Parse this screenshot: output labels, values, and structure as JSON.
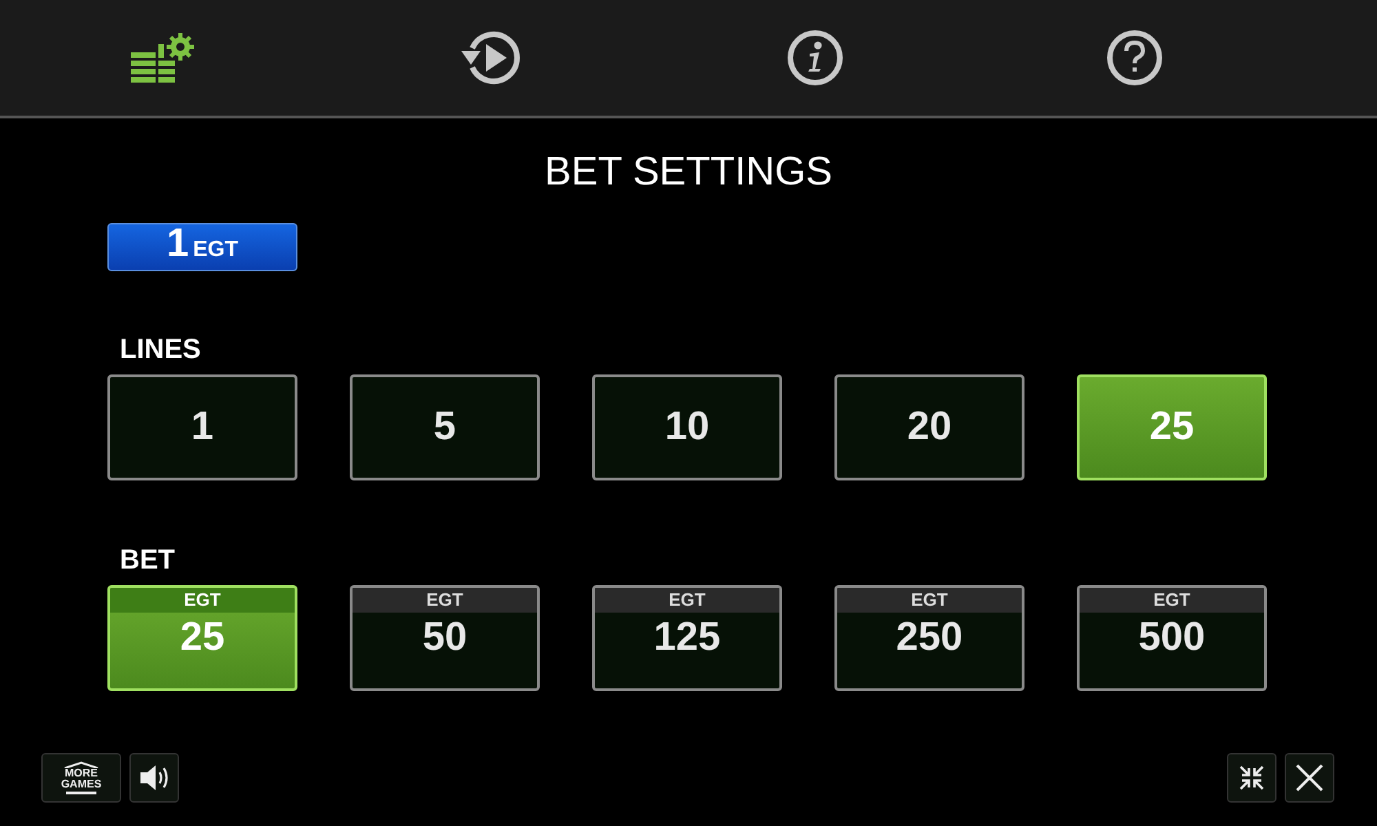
{
  "toolbar": [
    {
      "kind": "bet-settings",
      "selected": true
    },
    {
      "kind": "autoplay",
      "selected": false
    },
    {
      "kind": "info",
      "selected": false
    },
    {
      "kind": "help",
      "selected": false
    }
  ],
  "title": "BET SETTINGS",
  "denomination": {
    "value": "1",
    "unit": "EGT"
  },
  "lines": {
    "label": "LINES",
    "options": [
      {
        "value": "1",
        "selected": false
      },
      {
        "value": "5",
        "selected": false
      },
      {
        "value": "10",
        "selected": false
      },
      {
        "value": "20",
        "selected": false
      },
      {
        "value": "25",
        "selected": true
      }
    ]
  },
  "bet": {
    "label": "BET",
    "options": [
      {
        "currency": "EGT",
        "value": "25",
        "selected": true
      },
      {
        "currency": "EGT",
        "value": "50",
        "selected": false
      },
      {
        "currency": "EGT",
        "value": "125",
        "selected": false
      },
      {
        "currency": "EGT",
        "value": "250",
        "selected": false
      },
      {
        "currency": "EGT",
        "value": "500",
        "selected": false
      }
    ]
  },
  "more_games": {
    "label": "MORE GAMES"
  }
}
